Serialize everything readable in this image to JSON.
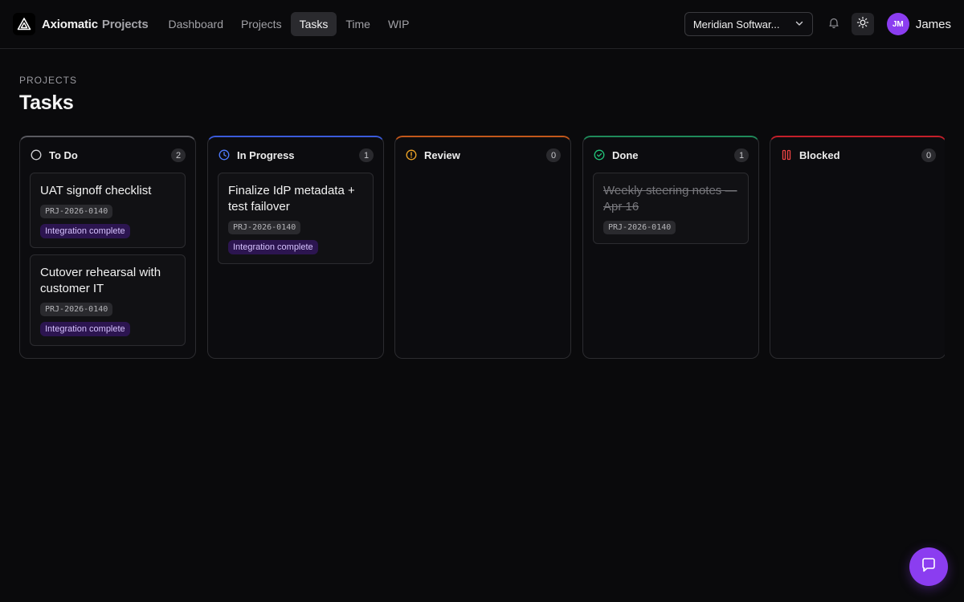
{
  "header": {
    "brand": "Axiomatic",
    "brand_sub": "Projects",
    "nav": [
      {
        "label": "Dashboard",
        "active": false
      },
      {
        "label": "Projects",
        "active": false
      },
      {
        "label": "Tasks",
        "active": true
      },
      {
        "label": "Time",
        "active": false
      },
      {
        "label": "WIP",
        "active": false
      }
    ],
    "org_select": "Meridian Softwar...",
    "user_initials": "JM",
    "user_name": "James"
  },
  "page": {
    "eyebrow": "PROJECTS",
    "title": "Tasks"
  },
  "columns": [
    {
      "title": "To Do",
      "count": "2",
      "accent": "#5a5a60",
      "icon": "circle-icon",
      "cards": [
        {
          "title": "UAT signoff checklist",
          "code": "PRJ-2026-0140",
          "tag": "Integration complete"
        },
        {
          "title": "Cutover rehearsal with customer IT",
          "code": "PRJ-2026-0140",
          "tag": "Integration complete"
        }
      ]
    },
    {
      "title": "In Progress",
      "count": "1",
      "accent": "#3b5bdb",
      "icon": "clock-icon",
      "cards": [
        {
          "title": "Finalize IdP metadata + test failover",
          "code": "PRJ-2026-0140",
          "tag": "Integration complete"
        }
      ]
    },
    {
      "title": "Review",
      "count": "0",
      "accent": "#c2571b",
      "icon": "alert-circle-icon",
      "cards": []
    },
    {
      "title": "Done",
      "count": "1",
      "accent": "#1f8a5a",
      "icon": "check-circle-icon",
      "cards": [
        {
          "title": "Weekly steering notes — Apr 16",
          "code": "PRJ-2026-0140",
          "done": true
        }
      ]
    },
    {
      "title": "Blocked",
      "count": "0",
      "accent": "#c41f2a",
      "icon": "pause-icon",
      "cards": []
    }
  ],
  "colors": {
    "brand_purple": "#8b3df0",
    "tag_text": "#d7c3ff",
    "tag_bg": "#2c1550"
  }
}
